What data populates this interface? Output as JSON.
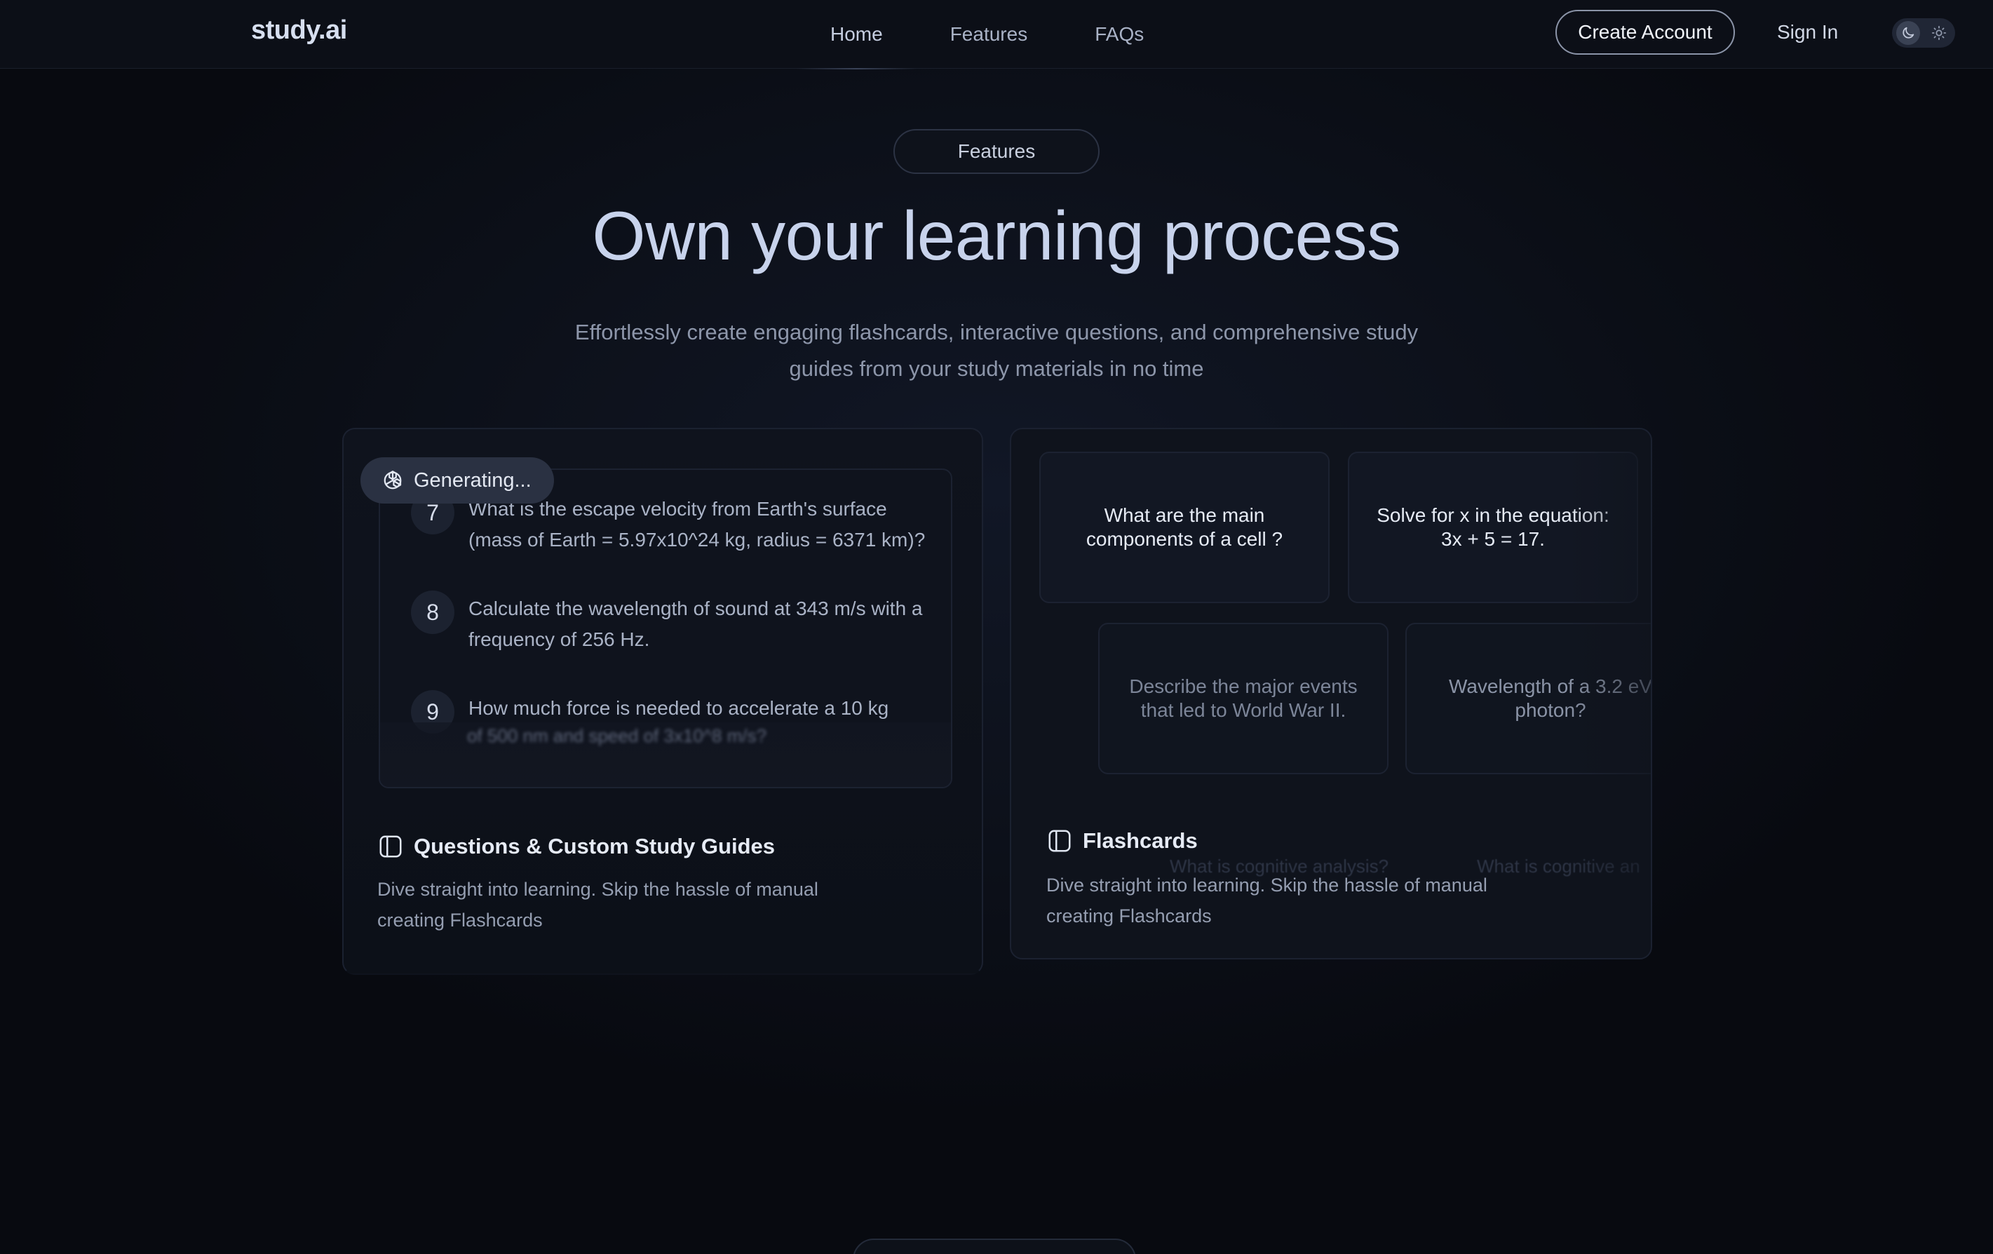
{
  "nav": {
    "logo": "study.ai",
    "links": [
      {
        "label": "Home",
        "active": true
      },
      {
        "label": "Features",
        "active": false
      },
      {
        "label": "FAQs",
        "active": false
      }
    ],
    "create_account": "Create Account",
    "sign_in": "Sign In",
    "theme_toggle": {
      "icons": [
        "moon-icon",
        "sun-icon"
      ],
      "selected": "dark"
    }
  },
  "hero": {
    "pill": "Features",
    "title": "Own your learning process",
    "subtitle": "Effortlessly create engaging flashcards, interactive questions, and comprehensive study guides from your study materials in no time"
  },
  "questions_card": {
    "generating_label": "Generating...",
    "items": [
      {
        "number": "7",
        "text": "What is the escape velocity from Earth's surface (mass of Earth = 5.97x10^24 kg, radius = 6371 km)?"
      },
      {
        "number": "8",
        "text": "Calculate the wavelength of sound at 343 m/s with a frequency of 256 Hz."
      },
      {
        "number": "9",
        "text": "How much force is needed to accelerate a 10 kg"
      }
    ],
    "blurred_text": "of 500 nm and speed of 3x10^8 m/s?",
    "title": "Questions & Custom Study Guides",
    "description": "Dive straight into learning. Skip the hassle of manual creating Flashcards"
  },
  "flashcards_card": {
    "cards": [
      "What are the main components of a cell ?",
      "Solve for x in the equation: 3x + 5 = 17.",
      "Describe the major events that led to World War II.",
      "Wavelength of a 3.2 eV photon?"
    ],
    "ghost_cards": [
      "What is cognitive analysis?",
      "What is cognitive an"
    ],
    "title": "Flashcards",
    "description": "Dive straight into learning. Skip the hassle of manual creating Flashcards"
  }
}
